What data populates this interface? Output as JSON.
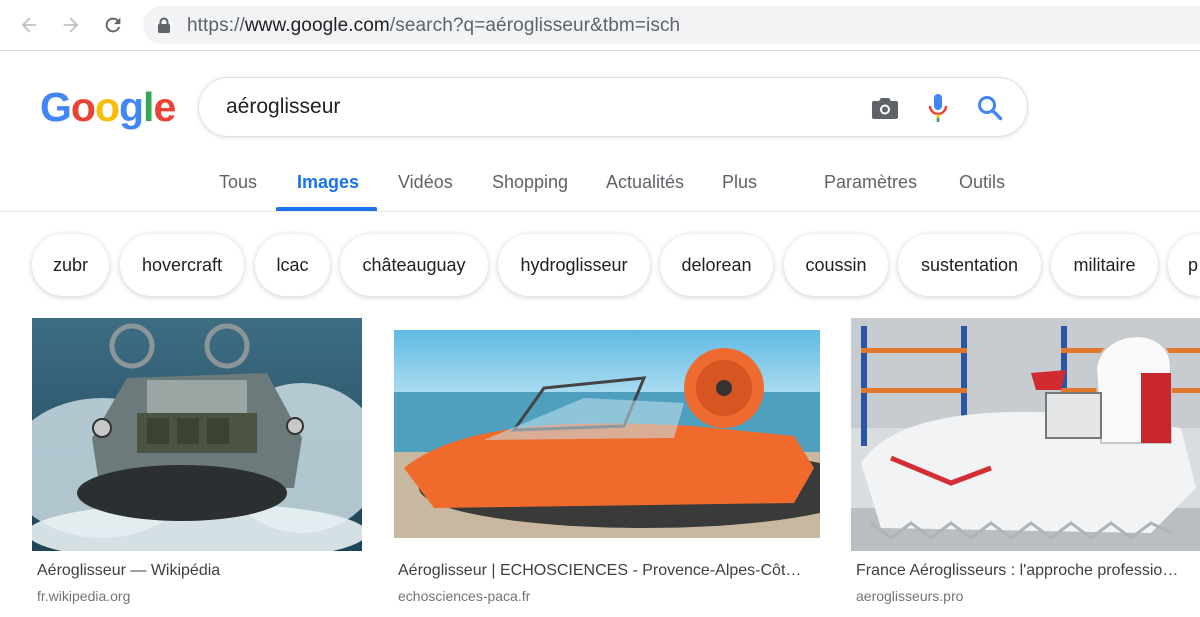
{
  "browser": {
    "url_host_prefix": "https://",
    "url_host": "www.google.com",
    "url_path": "/search?q=aéroglisseur&tbm=isch"
  },
  "logo": {
    "letters": [
      "G",
      "o",
      "o",
      "g",
      "l",
      "e"
    ]
  },
  "search": {
    "query": "aéroglisseur"
  },
  "tabs": [
    {
      "label": "Tous"
    },
    {
      "label": "Images",
      "active": true
    },
    {
      "label": "Vidéos"
    },
    {
      "label": "Shopping"
    },
    {
      "label": "Actualités"
    },
    {
      "label": "Plus"
    },
    {
      "label": "Paramètres"
    },
    {
      "label": "Outils"
    }
  ],
  "chips": [
    "zubr",
    "hovercraft",
    "lcac",
    "châteauguay",
    "hydroglisseur",
    "delorean",
    "coussin",
    "sustentation",
    "militaire",
    "p"
  ],
  "results": [
    {
      "title": "Aéroglisseur — Wikipédia",
      "domain": "fr.wikipedia.org"
    },
    {
      "title": "Aéroglisseur | ECHOSCIENCES - Provence-Alpes-Côt…",
      "domain": "echosciences-paca.fr"
    },
    {
      "title": "France Aéroglisseurs : l'approche professio…",
      "domain": "aeroglisseurs.pro"
    }
  ],
  "colors": {
    "accent": "#1a73e8",
    "logo_blue": "#4285f4",
    "logo_red": "#ea4335",
    "logo_yellow": "#fbbc05",
    "logo_green": "#34a853"
  }
}
